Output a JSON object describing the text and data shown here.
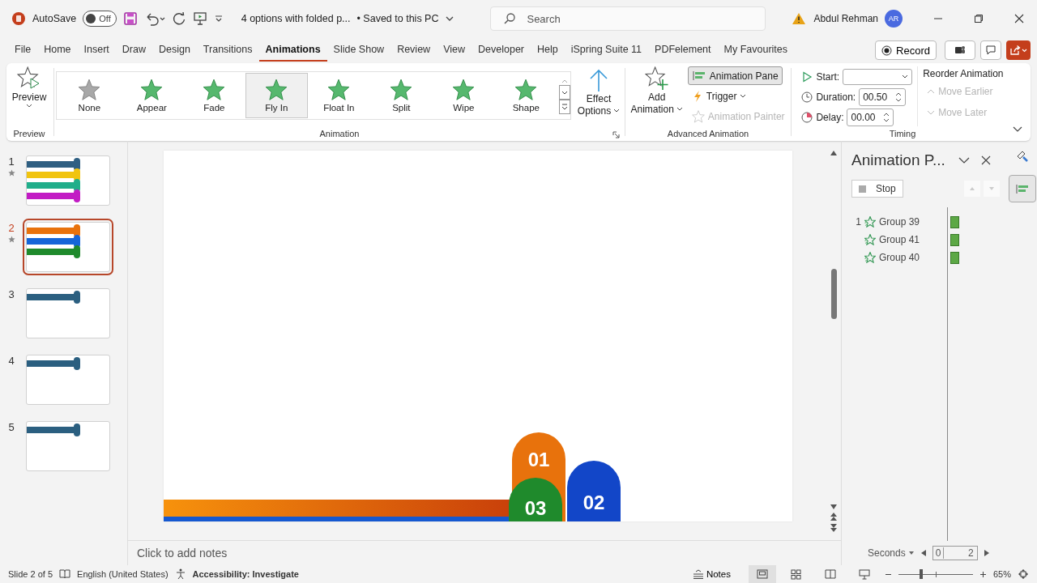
{
  "title_bar": {
    "autosave_label": "AutoSave",
    "autosave_toggle": {
      "label": "Off",
      "on": false
    },
    "document_title": "4 options with folded p...",
    "save_status": "• Saved to this PC",
    "search": {
      "placeholder": "Search"
    },
    "user_name": "Abdul Rehman",
    "avatar_initials": "AR"
  },
  "tabs": [
    {
      "label": "File",
      "selected": false
    },
    {
      "label": "Home",
      "selected": false
    },
    {
      "label": "Insert",
      "selected": false
    },
    {
      "label": "Draw",
      "selected": false
    },
    {
      "label": "Design",
      "selected": false
    },
    {
      "label": "Transitions",
      "selected": false
    },
    {
      "label": "Animations",
      "selected": true
    },
    {
      "label": "Slide Show",
      "selected": false
    },
    {
      "label": "Review",
      "selected": false
    },
    {
      "label": "View",
      "selected": false
    },
    {
      "label": "Developer",
      "selected": false
    },
    {
      "label": "Help",
      "selected": false
    },
    {
      "label": "iSpring Suite 11",
      "selected": false
    },
    {
      "label": "PDFelement",
      "selected": false
    },
    {
      "label": "My Favourites",
      "selected": false
    }
  ],
  "record_button": "Record",
  "ribbon": {
    "preview": {
      "button": "Preview",
      "group": "Preview"
    },
    "animation": {
      "group": "Animation",
      "effects": [
        {
          "label": "None",
          "kind": "none",
          "selected": false
        },
        {
          "label": "Appear",
          "kind": "entrance",
          "selected": false
        },
        {
          "label": "Fade",
          "kind": "entrance",
          "selected": false
        },
        {
          "label": "Fly In",
          "kind": "entrance",
          "selected": true
        },
        {
          "label": "Float In",
          "kind": "entrance",
          "selected": false
        },
        {
          "label": "Split",
          "kind": "entrance",
          "selected": false
        },
        {
          "label": "Wipe",
          "kind": "entrance",
          "selected": false
        },
        {
          "label": "Shape",
          "kind": "entrance",
          "selected": false
        }
      ],
      "effect_options": [
        "Effect",
        "Options"
      ]
    },
    "advanced": {
      "group": "Advanced Animation",
      "add_animation": [
        "Add",
        "Animation"
      ],
      "animation_pane": {
        "label": "Animation Pane",
        "selected": true
      },
      "trigger": {
        "label": "Trigger",
        "disabled": false
      },
      "animation_painter": {
        "label": "Animation Painter",
        "disabled": true
      }
    },
    "timing": {
      "group": "Timing",
      "start_label": "Start:",
      "duration_label": "Duration:",
      "duration": "00.50",
      "delay_label": "Delay:",
      "delay": "00.00",
      "reorder_label": "Reorder Animation",
      "move_earlier": {
        "label": "Move Earlier",
        "disabled": true
      },
      "move_later": {
        "label": "Move Later",
        "disabled": true
      }
    }
  },
  "slides": [
    {
      "number": "1",
      "animated": true,
      "selected": false,
      "bars": [
        {
          "color": "#2f5f82"
        },
        {
          "color": "#f1c40f"
        },
        {
          "color": "#1fae8a"
        },
        {
          "color": "#c21bc4"
        }
      ]
    },
    {
      "number": "2",
      "animated": true,
      "selected": true,
      "bars": [
        {
          "color": "#e8720c"
        },
        {
          "color": "#1565d8"
        },
        {
          "color": "#1f8a2c"
        }
      ]
    },
    {
      "number": "3",
      "animated": false,
      "selected": false,
      "bars": [
        {
          "color": "#2b5f80"
        }
      ]
    },
    {
      "number": "4",
      "animated": false,
      "selected": false,
      "bars": [
        {
          "color": "#2b5f80"
        }
      ]
    },
    {
      "number": "5",
      "animated": false,
      "selected": false,
      "bars": [
        {
          "color": "#2b5f80"
        }
      ]
    }
  ],
  "slide": {
    "badges": [
      {
        "label": "01",
        "color": "#e8720c"
      },
      {
        "label": "03",
        "color": "#1f8a2c"
      },
      {
        "label": "02",
        "color": "#1246c8"
      }
    ]
  },
  "notes_placeholder": "Click to add notes",
  "animation_pane": {
    "title": "Animation P...",
    "stop_button": "Stop",
    "items": [
      {
        "order": "1",
        "name": "Group 39"
      },
      {
        "name": "Group 41"
      },
      {
        "name": "Group 40"
      }
    ],
    "units": "Seconds",
    "scale": [
      "0",
      "2"
    ]
  },
  "status_bar": {
    "slide_info": "Slide 2 of 5",
    "language": "English (United States)",
    "accessibility": "Accessibility: Investigate",
    "notes": "Notes",
    "zoom": {
      "level": 0.3,
      "reading": "65%"
    }
  }
}
